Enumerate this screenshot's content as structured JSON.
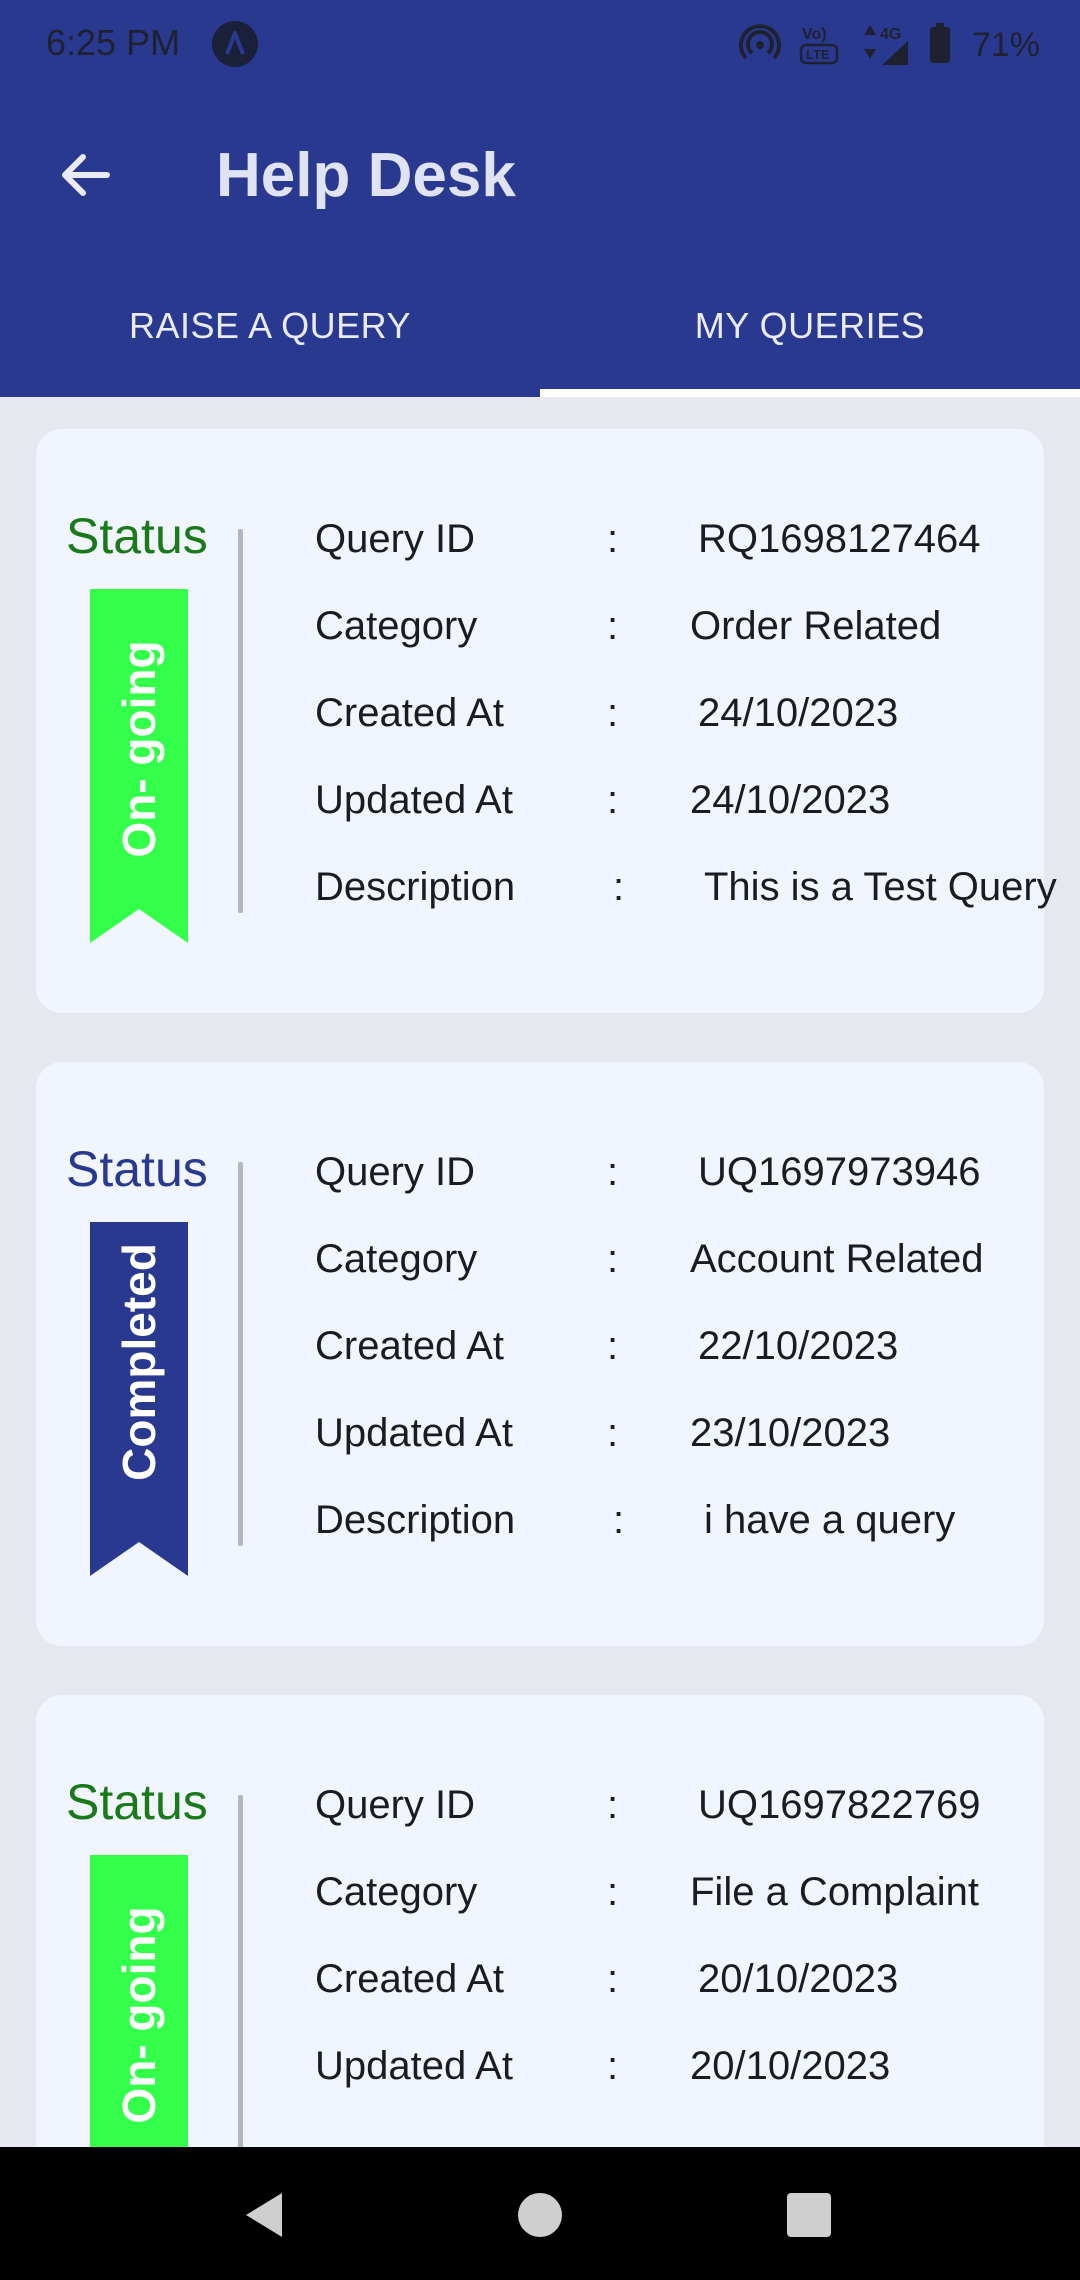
{
  "status_bar": {
    "time": "6:25 PM",
    "battery": "71%",
    "icons": [
      "app-a-icon",
      "hotspot-icon",
      "volte-icon",
      "data-4g-icon",
      "signal-icon",
      "battery-icon"
    ]
  },
  "app_bar": {
    "title": "Help Desk",
    "back_icon": "arrow-left-icon"
  },
  "tabs": [
    {
      "label": "RAISE A QUERY",
      "selected": false
    },
    {
      "label": "MY QUERIES",
      "selected": true
    }
  ],
  "field_labels": {
    "query_id": "Query ID",
    "category": "Category",
    "created_at": "Created At",
    "updated_at": "Updated At",
    "description": "Description",
    "separator": ":"
  },
  "status_heading": "Status",
  "colors": {
    "primary": "#2a3990",
    "ongoing": "#33ff4a",
    "ongoing_text": "#1a7a1a",
    "completed": "#2a3990"
  },
  "queries": [
    {
      "status": "On- going",
      "query_id": "RQ1698127464",
      "category": "Order Related",
      "created_at": "24/10/2023",
      "updated_at": "24/10/2023",
      "description": "This is a Test Query"
    },
    {
      "status": "Completed",
      "query_id": "UQ1697973946",
      "category": "Account Related",
      "created_at": "22/10/2023",
      "updated_at": "23/10/2023",
      "description": "i have a query"
    },
    {
      "status": "On- going",
      "query_id": "UQ1697822769",
      "category": "File a Complaint",
      "created_at": "20/10/2023",
      "updated_at": "20/10/2023",
      "description": ""
    }
  ],
  "nav_bar": {
    "icons": [
      "back-triangle-icon",
      "home-circle-icon",
      "recents-square-icon"
    ]
  }
}
